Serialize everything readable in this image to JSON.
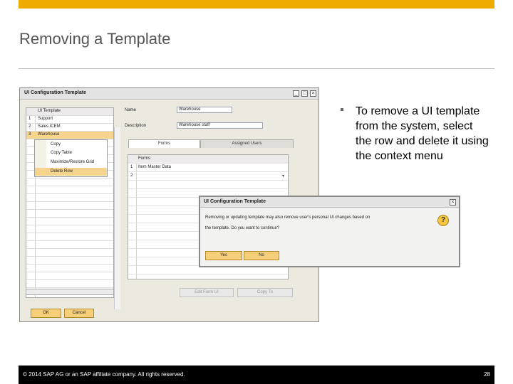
{
  "slide": {
    "title": "Removing a Template",
    "bullet": "To remove a UI template from the system, select the row and delete it using the context menu",
    "footer_copyright": "© 2014 SAP AG or an SAP affiliate company. All rights reserved.",
    "page_number": "28"
  },
  "window": {
    "title": "UI Configuration Template",
    "controls": [
      "_",
      "□",
      "×"
    ],
    "list": {
      "header": "UI Template",
      "rows": [
        {
          "num": "1",
          "name": "Support"
        },
        {
          "num": "2",
          "name": "Sales ICEM"
        },
        {
          "num": "3",
          "name": "Warehouse"
        }
      ]
    },
    "context_menu": [
      "Copy",
      "Copy Table",
      "Maximize/Restore Grid",
      "Delete Row"
    ],
    "name_label": "Name",
    "name_value": "Warehouse",
    "description_label": "Description",
    "description_value": "Warehouse staff",
    "tabs": [
      "Forms",
      "Assigned Users"
    ],
    "forms_header": "Forms",
    "forms_rows": [
      {
        "num": "1",
        "name": "Item Master Data"
      },
      {
        "num": "2",
        "name": ""
      }
    ],
    "edit_form_button": "Edit Form UI",
    "copy_to_button": "Copy To",
    "ok_button": "OK",
    "cancel_button": "Cancel"
  },
  "dialog": {
    "title": "UI Configuration Template",
    "message_line1": "Removing or updating template may also remove user's personal UI changes based on",
    "message_line2": "the template. Do you want to continue?",
    "yes_button": "Yes",
    "no_button": "No",
    "close": "×",
    "question_mark": "?"
  },
  "colors": {
    "sap_gold": "#f0ab00",
    "selection": "#f6d48e",
    "button_gold": "#f7cf7a"
  }
}
